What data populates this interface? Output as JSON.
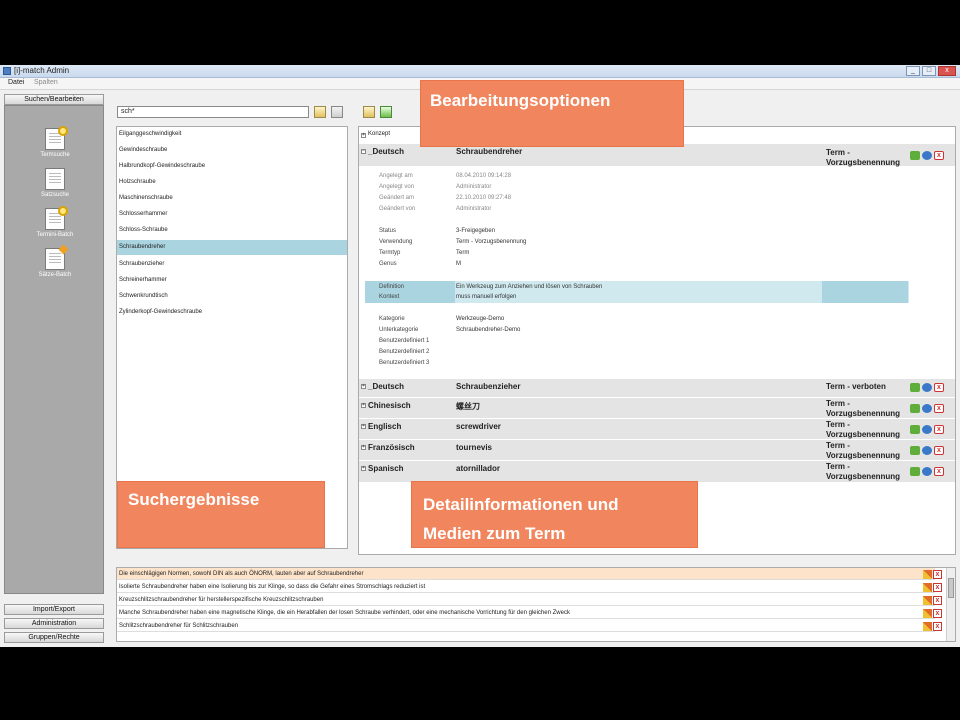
{
  "window": {
    "title": "[i]-match Admin",
    "buttons": [
      "_",
      "□",
      "x"
    ]
  },
  "menu": [
    {
      "label": "Datei"
    },
    {
      "label": "Spalten"
    }
  ],
  "nav": {
    "top_button": "Suchen/Bearbeiten",
    "items": [
      {
        "label": "Termsuche",
        "icon": "term-search-icon"
      },
      {
        "label": "Satzsuche",
        "icon": "sentence-search-icon"
      },
      {
        "label": "Termini-Batch",
        "icon": "term-batch-icon"
      },
      {
        "label": "Sätze-Batch",
        "icon": "sentence-batch-icon"
      }
    ],
    "bottom_buttons": [
      "Import/Export",
      "Administration",
      "Gruppen/Rechte"
    ]
  },
  "search": {
    "value": "sch*",
    "results": [
      "Eilganggeschwindigkeit",
      "Gewindeschraube",
      "Halbrundkopf-Gewindeschraube",
      "Holzschraube",
      "Maschinenschraube",
      "Schlosserhammer",
      "Schloss-Schraube",
      "Schraubendreher",
      "Schraubenzieher",
      "Schreinerhammer",
      "Schwenkrundtisch",
      "Zylinderkopf-Gewindeschraube"
    ],
    "selected_index": 7
  },
  "detail": {
    "konzept": "Konzept",
    "main": {
      "lang": "_Deutsch",
      "term": "Schraubendreher",
      "status": "Term - Vorzugsbenennung"
    },
    "meta": [
      {
        "label": "Angelegt am",
        "value": "08.04.2010 09:14:28"
      },
      {
        "label": "Angelegt von",
        "value": "Administrator"
      },
      {
        "label": "Geändert am",
        "value": "22.10.2010 09:27:48"
      },
      {
        "label": "Geändert von",
        "value": "Administrator"
      }
    ],
    "props": [
      {
        "label": "Status",
        "value": "3-Freigegeben"
      },
      {
        "label": "Verwendung",
        "value": "Term - Vorzugsbenennung"
      },
      {
        "label": "Termtyp",
        "value": "Term"
      },
      {
        "label": "Genus",
        "value": "M"
      }
    ],
    "highlight": [
      {
        "label": "Definition",
        "value": "Ein Werkzeug zum Anziehen und lösen von Schrauben"
      },
      {
        "label": "Kontext",
        "value": "muss manuell erfolgen"
      }
    ],
    "cats": [
      {
        "label": "Kategorie",
        "value": "Werkzeuge-Demo"
      },
      {
        "label": "Unterkategorie",
        "value": "Schraubendreher-Demo"
      },
      {
        "label": "Benutzerdefiniert 1",
        "value": ""
      },
      {
        "label": "Benutzerdefiniert 2",
        "value": ""
      },
      {
        "label": "Benutzerdefiniert 3",
        "value": ""
      }
    ],
    "others": [
      {
        "lang": "_Deutsch",
        "term": "Schraubenzieher",
        "status": "Term - verboten"
      },
      {
        "lang": "Chinesisch",
        "term": "螺丝刀",
        "status": "Term - Vorzugsbenennung"
      },
      {
        "lang": "Englisch",
        "term": "screwdriver",
        "status": "Term - Vorzugsbenennung"
      },
      {
        "lang": "Französisch",
        "term": "tournevis",
        "status": "Term - Vorzugsbenennung"
      },
      {
        "lang": "Spanisch",
        "term": "atornillador",
        "status": "Term - Vorzugsbenennung"
      }
    ]
  },
  "sentences": [
    "Die einschlägigen Normen, sowohl DIN als auch ÖNORM, lauten aber auf Schraubendreher",
    "Isolierte Schraubendreher haben eine Isolierung bis zur Klinge, so dass die Gefahr eines Stromschlags reduziert ist",
    "Kreuzschlitzschraubendreher für herstellerspezifische Kreuzschlitzschrauben",
    "Manche Schraubendreher haben eine magnetische Klinge, die ein Herabfallen der losen Schraube verhindert, oder eine mechanische Vorrichtung für den gleichen Zweck",
    "Schlitzschraubendreher für Schlitzschrauben"
  ],
  "callouts": {
    "edit": "Bearbeitungsoptionen",
    "results": "Suchergebnisse",
    "detail_line1": "Detailinformationen und",
    "detail_line2": "Medien zum Term"
  },
  "colors": {
    "callout": "#f0855e",
    "selection": "#a9d4e0"
  }
}
